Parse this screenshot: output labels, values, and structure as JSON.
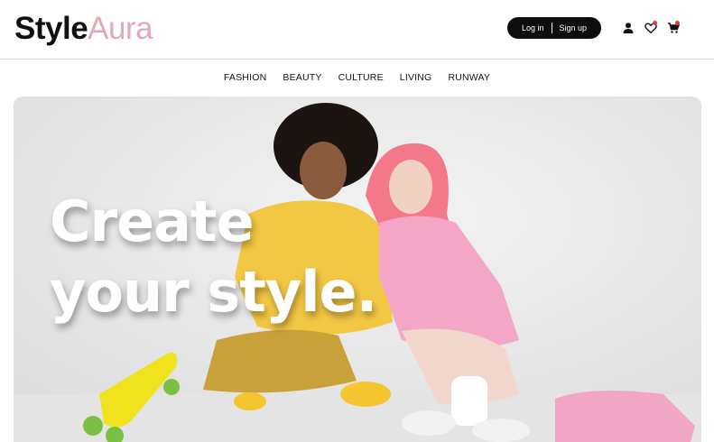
{
  "header": {
    "logo_part1": "Style",
    "logo_part2": "Aura",
    "login_label": "Log in",
    "signup_label": "Sign up",
    "icons": [
      "user-icon",
      "heart-icon",
      "cart-icon"
    ],
    "notification_color": "#e53935"
  },
  "nav": {
    "items": [
      "FASHION",
      "BEAUTY",
      "CULTURE",
      "LIVING",
      "RUNWAY"
    ]
  },
  "hero": {
    "line1": "Create",
    "line2": "your style."
  },
  "colors": {
    "brand_accent": "#e2aab4",
    "dark": "#0d0d0d"
  }
}
